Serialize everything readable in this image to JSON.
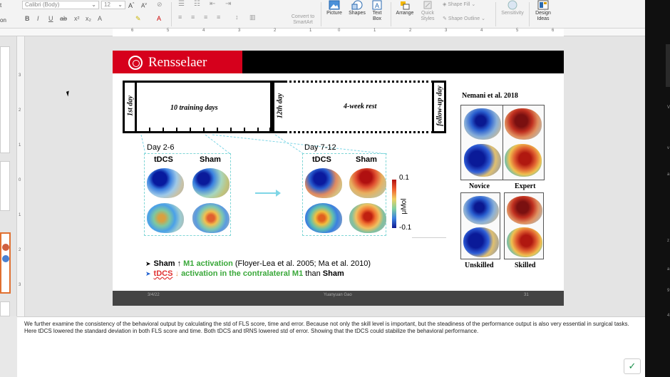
{
  "ribbon": {
    "left_chars": [
      "t",
      "on"
    ],
    "font_name": "Calibri (Body)",
    "font_size": "12",
    "format_buttons": [
      "B",
      "I",
      "U",
      "ab",
      "x²",
      "x₂",
      "A"
    ],
    "align_icons": [
      "align-left",
      "align-center",
      "align-right",
      "justify"
    ],
    "convert_label": "Convert to SmartArt",
    "picture_label": "Picture",
    "shapes_label": "Shapes",
    "textbox_label": "Text Box",
    "arrange_label": "Arrange",
    "quick_styles_label": "Quick Styles",
    "shape_fill_label": "Shape Fill",
    "shape_outline_label": "Shape Outline",
    "sensitivity_label": "Sensitivity",
    "design_ideas_label": "Design Ideas"
  },
  "ruler": {
    "h_ticks": [
      "6",
      "5",
      "4",
      "3",
      "2",
      "1",
      "0",
      "1",
      "2",
      "3",
      "4",
      "5",
      "6"
    ],
    "v_ticks": [
      "3",
      "2",
      "1",
      "0",
      "1",
      "2",
      "3"
    ]
  },
  "slide": {
    "logo": "Rensselaer",
    "first_day": "1st day",
    "training": "10 training days",
    "twelfth_day": "12th day",
    "rest": "4-week rest",
    "followup": "follow-up day",
    "group1_label": "Day 2-6",
    "group2_label": "Day 7-12",
    "col_tdcs": "tDCS",
    "col_sham": "Sham",
    "colorbar_top": "0.1",
    "colorbar_bottom": "-0.1",
    "colorbar_unit": "μMol",
    "nemani_title": "Nemani et al. 2018",
    "novice": "Novice",
    "expert": "Expert",
    "unskilled": "Unskilled",
    "skilled": "Skilled",
    "bullet1": {
      "sham": "Sham",
      "arrow": "↑",
      "activation": "M1 activation",
      "refs": "(Floyer-Lea et al. 2005; Ma et al. 2010)"
    },
    "bullet2": {
      "tdcs": "tDCS",
      "arrow": "↓",
      "activation": "activation in the contralateral M1",
      "than": "than",
      "sham": "Sham"
    },
    "footer_date": "3/4/22",
    "footer_author": "Yuanyuan Gao",
    "footer_page": "31"
  },
  "notes": {
    "line1": "We further examine the consistency of the behavioral output by calculating the std of FLS score, time and error. Because not only the skill level is important, but the steadiness of the performance output is also very essential in surgical tasks.",
    "line2": "Here tDCS lowered the standard deviation in both FLS score and time. Both tDCS and tRNS lowered std of error. Showing that the tDCS could stabilize the behavioral performance."
  },
  "right_strip": {
    "chars": [
      "V",
      "v",
      "a",
      "z",
      "a",
      "9",
      "4"
    ]
  },
  "colors": {
    "brand_red": "#d6001c",
    "highlight_green": "#3aa83a",
    "highlight_red": "#e03030",
    "accent_cyan": "#7fd6e6"
  }
}
